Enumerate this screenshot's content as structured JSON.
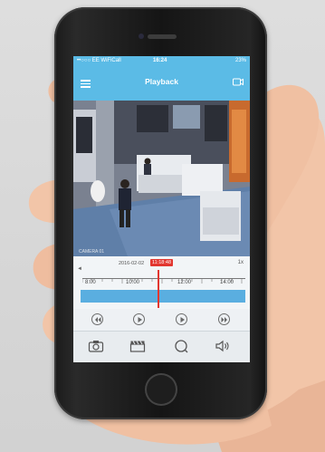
{
  "status": {
    "carrier": "••○○○ EE WiFiCall",
    "time": "16:24",
    "battery": "23%"
  },
  "header": {
    "title": "Playback"
  },
  "video": {
    "camera_label": "CAMERA 01"
  },
  "timeline": {
    "date": "2016-02-02",
    "current_time": "11:18:48",
    "zoom": "1x",
    "tick_labels": [
      "8:00",
      "10:00",
      "12:00",
      "14:00"
    ],
    "progress": 0.46
  },
  "colors": {
    "accent": "#5bbbe6",
    "cursor": "#e2362f",
    "timeline_bar": "#5aaee0"
  },
  "controls": [
    "rewind-icon",
    "play-icon",
    "play-icon",
    "fast-forward-icon"
  ],
  "tabs": [
    "camera-icon",
    "clapperboard-icon",
    "search-icon",
    "speaker-icon"
  ]
}
